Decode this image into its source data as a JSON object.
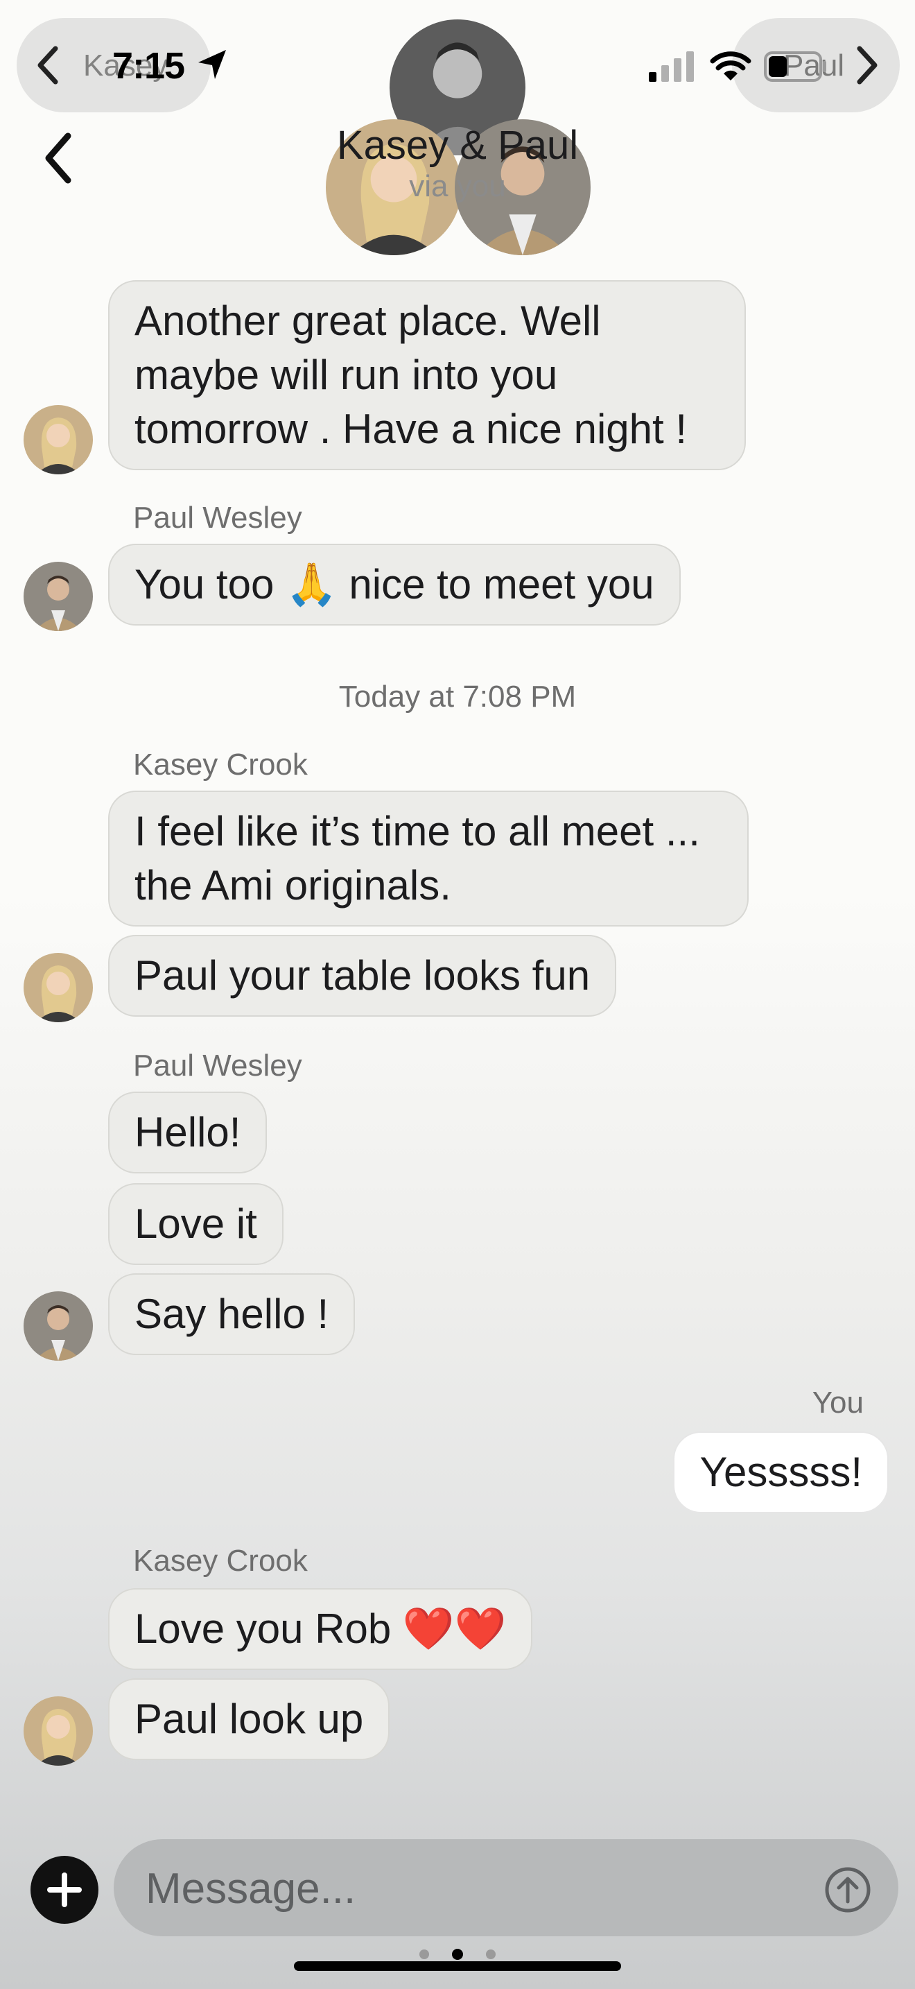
{
  "status_bar": {
    "time": "7:15",
    "back_app_label": "Kasey",
    "forward_app_label": "Paul"
  },
  "header": {
    "title": "Kasey & Paul",
    "subtitle": "via you"
  },
  "messages": [
    {
      "sender": "",
      "text_lines": [
        "Another great place. Well",
        "maybe will run into you",
        "tomorrow . Have a nice night !"
      ]
    },
    {
      "sender": "Paul Wesley",
      "text": "You too 🙏 nice to meet you"
    },
    {
      "timestamp": "Today at 7:08 PM"
    },
    {
      "sender": "Kasey Crook",
      "text_lines": [
        "I feel like it’s time to all meet ...",
        "the Ami originals."
      ]
    },
    {
      "text": "Paul your table looks fun"
    },
    {
      "sender": "Paul Wesley",
      "text": "Hello!"
    },
    {
      "text": "Love it"
    },
    {
      "text": "Say hello !"
    },
    {
      "sender": "You",
      "text": "Yesssss!"
    },
    {
      "sender": "Kasey Crook",
      "text": "Love you Rob ❤️❤️"
    },
    {
      "text": "Paul look up"
    }
  ],
  "composer": {
    "placeholder": "Message..."
  },
  "colors": {
    "bubble_received": "#ecece9",
    "bubble_sent": "#ffffff",
    "text_secondary": "#6e6e6e",
    "input_field": "#b7b9ba"
  },
  "icons": [
    "chevron-left-icon",
    "chevron-right-icon",
    "location-arrow-icon",
    "signal-icon",
    "wifi-icon",
    "battery-icon",
    "back-icon",
    "plus-icon",
    "send-arrow-icon"
  ]
}
